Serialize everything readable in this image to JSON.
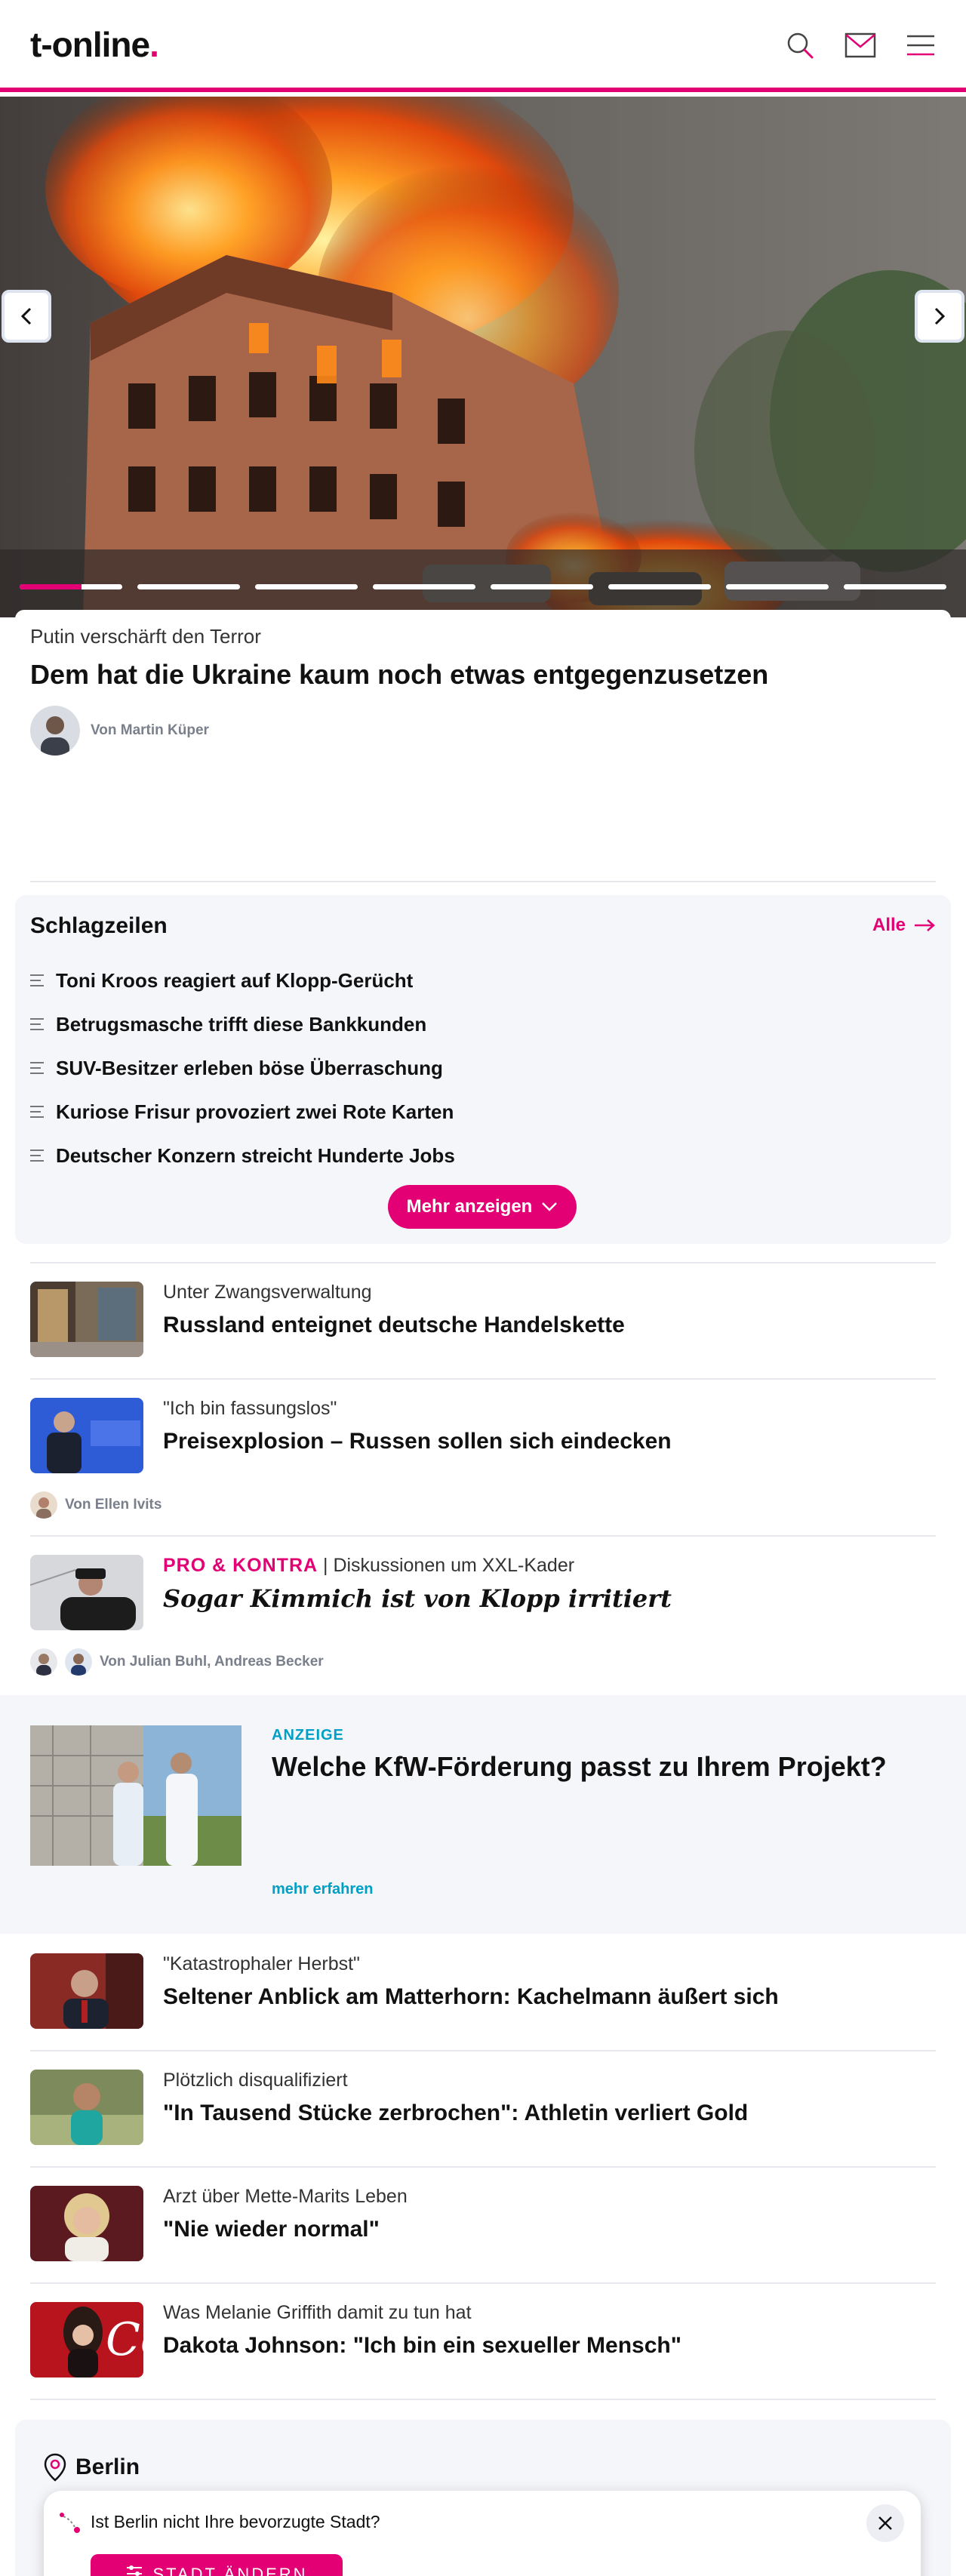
{
  "header": {
    "logo_text": "t-online",
    "logo_dot": ".",
    "icons": [
      "search-icon",
      "mail-icon",
      "menu-icon"
    ],
    "accent_color": "#e20074"
  },
  "hero": {
    "slide_count": 8,
    "active_slide_progress": 0.6,
    "kicker": "Putin verschärft den Terror",
    "title": "Dem hat die Ukraine kaum noch etwas entgegenzusetzen",
    "author": "Von Martin Küper"
  },
  "headlines": {
    "title": "Schlagzeilen",
    "all_label": "Alle",
    "items": [
      "Toni Kroos reagiert auf Klopp-Gerücht",
      "Betrugsmasche trifft diese Bankkunden",
      "SUV-Besitzer erleben böse Überraschung",
      "Kuriose Frisur provoziert zwei Rote Karten",
      "Deutscher Konzern streicht Hunderte Jobs"
    ],
    "more_label": "Mehr anzeigen"
  },
  "articles": [
    {
      "kicker": "Unter Zwangsverwaltung",
      "title": "Russland enteignet deutsche Handelskette"
    },
    {
      "kicker": "\"Ich bin fassungslos\"",
      "title": "Preisexplosion – Russen sollen sich eindecken",
      "author": "Von Ellen Ivits"
    },
    {
      "kicker_label": "PRO & KONTRA",
      "kicker_sep": " | ",
      "kicker": "Diskussionen um XXL-Kader",
      "title": "Sogar Kimmich ist von Klopp irritiert",
      "author": "Von Julian Buhl, Andreas Becker"
    }
  ],
  "ad": {
    "label": "ANZEIGE",
    "title": "Welche KfW-Förderung passt zu Ihrem Projekt?",
    "more": "mehr erfahren"
  },
  "articles2": [
    {
      "kicker": "\"Katastrophaler Herbst\"",
      "title": "Seltener Anblick am Matterhorn: Kachelmann äußert sich"
    },
    {
      "kicker": "Plötzlich disqualifiziert",
      "title": "\"In Tausend Stücke zerbrochen\": Athletin verliert Gold"
    },
    {
      "kicker": "Arzt über Mette-Marits Leben",
      "title": "\"Nie wieder normal\""
    },
    {
      "kicker": "Was Melanie Griffith damit zu tun hat",
      "title": "Dakota Johnson: \"Ich bin ein sexueller Mensch\""
    }
  ],
  "local": {
    "city": "Berlin",
    "question": "Ist Berlin nicht Ihre bevorzugte Stadt?",
    "change_label": "STADT ÄNDERN"
  }
}
